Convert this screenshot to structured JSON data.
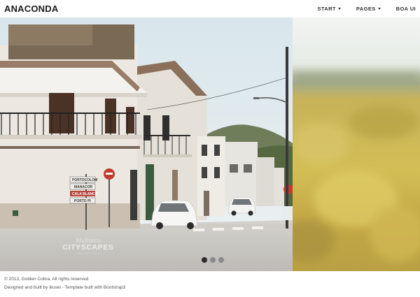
{
  "navbar": {
    "brand": "ANACONDA",
    "items": [
      {
        "label": "START",
        "dropdown": true
      },
      {
        "label": "PAGES",
        "dropdown": true
      },
      {
        "label": "BOA UI",
        "dropdown": false
      }
    ]
  },
  "carousel": {
    "slide_count": 3,
    "active_index": 0,
    "watermark": {
      "script": "Mallorca",
      "title": "CITYSCAPES",
      "subtitle": "COLLECTION"
    },
    "street_signs": [
      "PORTOCOLOM",
      "MANACOR",
      "CALA BLANCA",
      "PORTO PI"
    ]
  },
  "footer": {
    "copyright": "© 2013, Golden Cobra. All rights reserved",
    "credits": "Designed and built by ikusei - Template built with Bootstrap3"
  },
  "colors": {
    "sky": "#dde7ea",
    "building": "#ece8e1",
    "road": "#c6c4c0",
    "field": "#c9b04a",
    "active_dot": "#2b2b2b",
    "inactive_dot": "#8a8a8a"
  }
}
